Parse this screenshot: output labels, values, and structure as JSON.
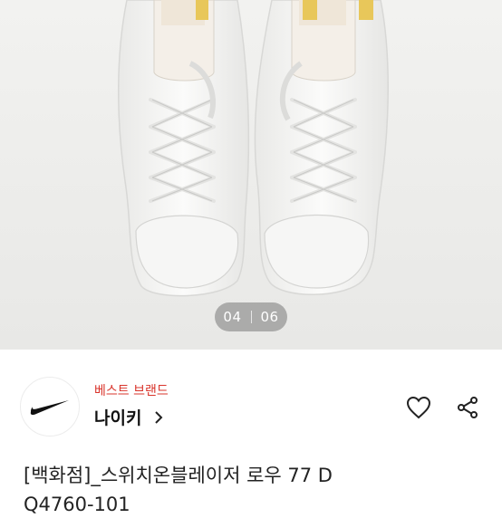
{
  "gallery": {
    "current": "04",
    "total": "06"
  },
  "brand": {
    "tag": "베스트 브랜드",
    "name": "나이키",
    "logo_icon": "nike-swoosh-logo",
    "tag_color": "#d9342b"
  },
  "actions": {
    "like_icon": "heart-icon",
    "share_icon": "share-icon"
  },
  "product": {
    "title_line1": "[백화점]_스위치온블레이저 로우 77 D",
    "title_line2": "Q4760-101"
  }
}
